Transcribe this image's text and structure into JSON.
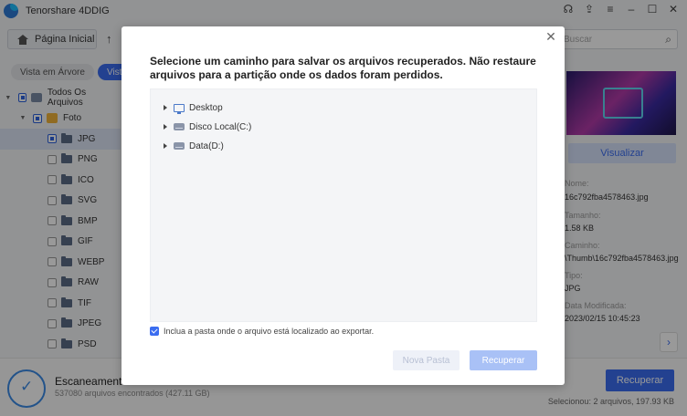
{
  "app": {
    "title": "Tenorshare 4DDIG",
    "window_controls": [
      "headset-icon",
      "share-icon",
      "menu-icon",
      "minimize-icon",
      "maximize-icon",
      "close-icon"
    ]
  },
  "toolbar": {
    "home_label": "Página Inicial",
    "search_placeholder": "Buscar"
  },
  "view_tabs": [
    {
      "label": "Vista em Árvore",
      "active": false
    },
    {
      "label": "Vista de Arquivo",
      "active": true
    }
  ],
  "tree": {
    "all_files": "Todos Os Arquivos",
    "photo": "Foto",
    "types": [
      "JPG",
      "PNG",
      "ICO",
      "SVG",
      "BMP",
      "GIF",
      "WEBP",
      "RAW",
      "TIF",
      "JPEG",
      "PSD"
    ],
    "selected": "JPG"
  },
  "preview": {
    "view_button": "Visualizar",
    "fields": [
      {
        "label": "Nome:",
        "value": "16c792fba4578463.jpg"
      },
      {
        "label": "Tamanho:",
        "value": "1.58 KB"
      },
      {
        "label": "Caminho:",
        "value": "\\Thumb\\16c792fba4578463.jpg"
      },
      {
        "label": "Tipo:",
        "value": "JPG"
      },
      {
        "label": "Data Modificada:",
        "value": "2023/02/15 10:45:23"
      }
    ]
  },
  "status": {
    "title": "Escaneamento Concluído",
    "subtitle": "537080 arquivos encontrados (427.11 GB)",
    "recover_button": "Recuperar",
    "selection_info": "Selecionou: 2 arquivos, 197.93 KB"
  },
  "dialog": {
    "title": "Selecione um caminho para salvar os arquivos recuperados. Não restaure arquivos para a partição onde os dados foram perdidos.",
    "locations": [
      {
        "label": "Desktop",
        "icon": "desktop-icon"
      },
      {
        "label": "Disco Local(C:)",
        "icon": "disk-icon"
      },
      {
        "label": "Data(D:)",
        "icon": "disk-icon"
      }
    ],
    "include_folder_label": "Inclua a pasta onde o arquivo está localizado ao exportar.",
    "include_folder_checked": true,
    "new_folder_button": "Nova Pasta",
    "recover_button": "Recuperar"
  },
  "colors": {
    "accent": "#3b6df0",
    "overlay": "rgba(0,0,0,0.40)"
  }
}
